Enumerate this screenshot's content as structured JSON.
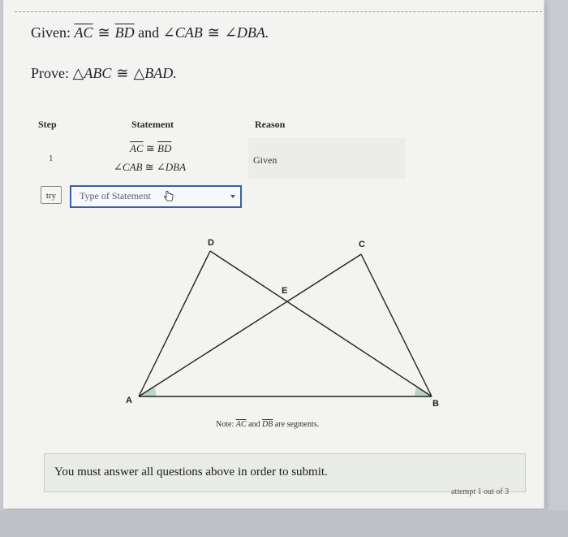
{
  "problem": {
    "given_prefix": "Given:",
    "given_seg1": "AC",
    "given_cong": "≅",
    "given_seg2": "BD",
    "given_and": "and",
    "given_ang1": "∠CAB",
    "given_ang2": "∠DBA.",
    "prove_prefix": "Prove:",
    "prove_tri1": "△ABC",
    "prove_cong": "≅",
    "prove_tri2": "△BAD."
  },
  "table": {
    "headers": {
      "step": "Step",
      "statement": "Statement",
      "reason": "Reason"
    },
    "rows": [
      {
        "step": "1",
        "statement_line1_seg1": "AC",
        "statement_line1_cong": "≅",
        "statement_line1_seg2": "BD",
        "statement_line2_ang1": "∠CAB",
        "statement_line2_cong": "≅",
        "statement_line2_ang2": "∠DBA",
        "reason": "Given"
      }
    ]
  },
  "input_row": {
    "try_label": "try",
    "select_value": "Type of Statement"
  },
  "diagram": {
    "labels": {
      "A": "A",
      "B": "B",
      "C": "C",
      "D": "D",
      "E": "E"
    }
  },
  "note": {
    "prefix": "Note:",
    "seg1": "AC",
    "and": "and",
    "seg2": "DB",
    "suffix": "are segments."
  },
  "submit": {
    "message": "You must answer all questions above in order to submit."
  },
  "attempt": {
    "text": "attempt 1 out of 3"
  },
  "colors": {
    "select_border": "#3b5f9e",
    "angle_mark": "#b9d8c2",
    "panel_bg": "#e9ece6"
  }
}
